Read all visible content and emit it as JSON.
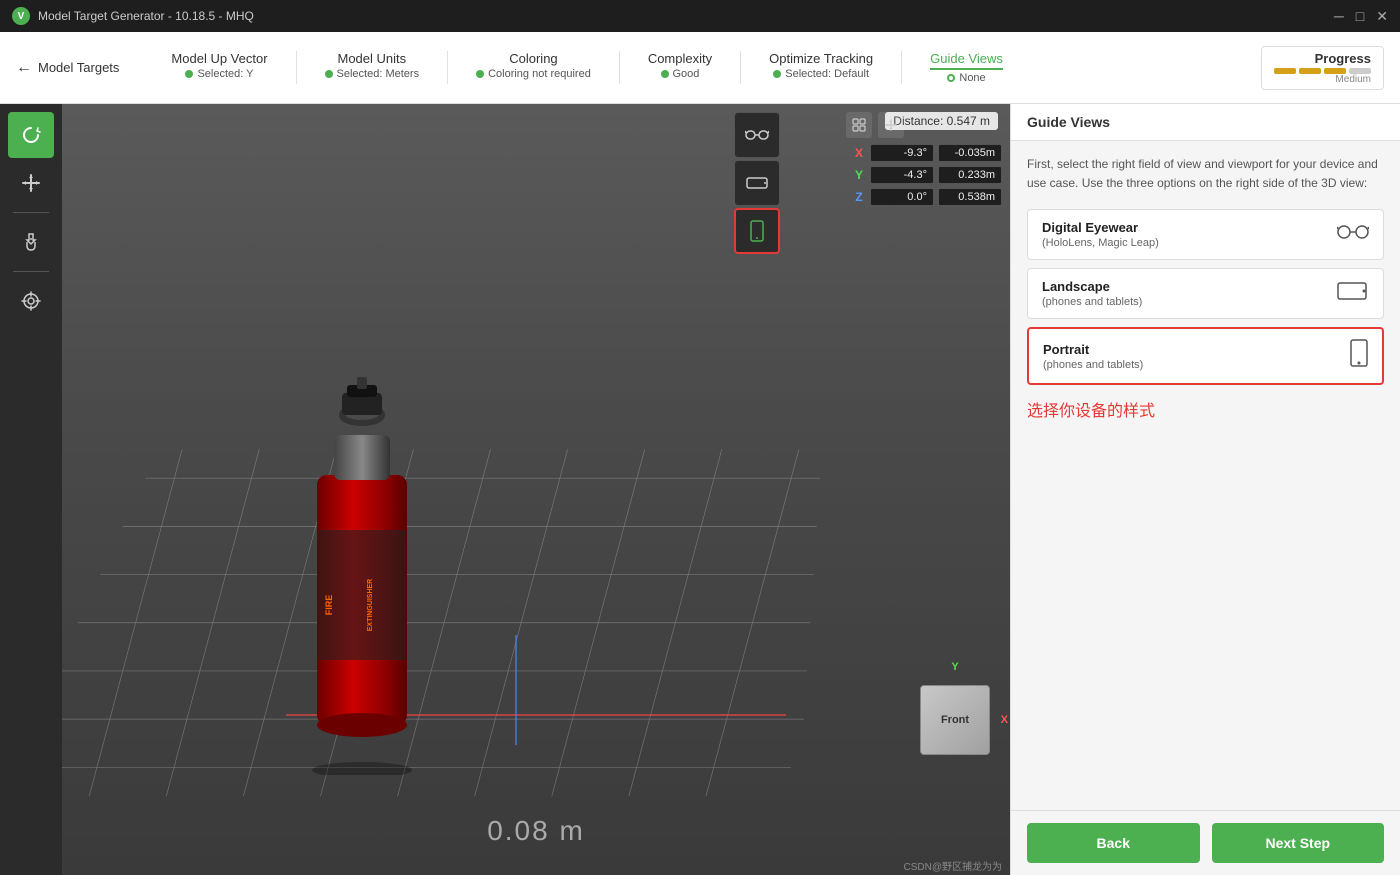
{
  "titlebar": {
    "title": "Model Target Generator - 10.18.5 - MHQ",
    "logo": "V"
  },
  "navbar": {
    "back_label": "Model Targets",
    "steps": [
      {
        "id": "model-up-vector",
        "name": "Model Up Vector",
        "status": "Selected: Y",
        "dot": "green"
      },
      {
        "id": "model-units",
        "name": "Model Units",
        "status": "Selected: Meters",
        "dot": "green"
      },
      {
        "id": "coloring",
        "name": "Coloring",
        "status": "Coloring not required",
        "dot": "green"
      },
      {
        "id": "complexity",
        "name": "Complexity",
        "status": "Good",
        "dot": "green"
      },
      {
        "id": "optimize-tracking",
        "name": "Optimize Tracking",
        "status": "Selected: Default",
        "dot": "green"
      },
      {
        "id": "guide-views",
        "name": "Guide Views",
        "status": "None",
        "dot": "outline",
        "active": true
      }
    ],
    "progress": {
      "label": "Progress",
      "sublabel": "Medium",
      "bars": [
        3,
        3,
        1
      ]
    }
  },
  "viewport": {
    "distance_label": "Distance: 0.547 m",
    "coords": {
      "x": {
        "label": "X",
        "rot": "-9.3°",
        "pos": "-0.035m"
      },
      "y": {
        "label": "Y",
        "rot": "-4.3°",
        "pos": "0.233m"
      },
      "z": {
        "label": "Z",
        "rot": "0.0°",
        "pos": "0.538m"
      }
    },
    "scale": "0.08 m",
    "cube": {
      "face": "Front"
    }
  },
  "right_panel": {
    "header": "Guide Views",
    "intro": "First, select the right field of view and viewport for your device and use case. Use the three options on the right side of the 3D view:",
    "options": [
      {
        "id": "digital-eyewear",
        "title": "Digital Eyewear",
        "subtitle": "(HoloLens, Magic Leap)",
        "icon": "eyewear",
        "selected": false
      },
      {
        "id": "landscape",
        "title": "Landscape",
        "subtitle": "(phones and tablets)",
        "icon": "landscape",
        "selected": false
      },
      {
        "id": "portrait",
        "title": "Portrait",
        "subtitle": "(phones and tablets)",
        "icon": "portrait",
        "selected": true
      }
    ],
    "note": "选择你设备的样式",
    "back_label": "Back",
    "next_label": "Next Step"
  },
  "tools": {
    "left": [
      {
        "id": "rotate",
        "icon": "↺",
        "active": true
      },
      {
        "id": "move",
        "icon": "↕",
        "active": false
      },
      {
        "id": "pan",
        "icon": "✋",
        "active": false
      },
      {
        "id": "target",
        "icon": "⊕",
        "active": false
      }
    ]
  },
  "view_modes": [
    {
      "id": "eyewear",
      "active": false
    },
    {
      "id": "landscape-mode",
      "active": false
    },
    {
      "id": "portrait-mode",
      "active": true
    }
  ],
  "watermark": "CSDN@野区捕龙为为"
}
